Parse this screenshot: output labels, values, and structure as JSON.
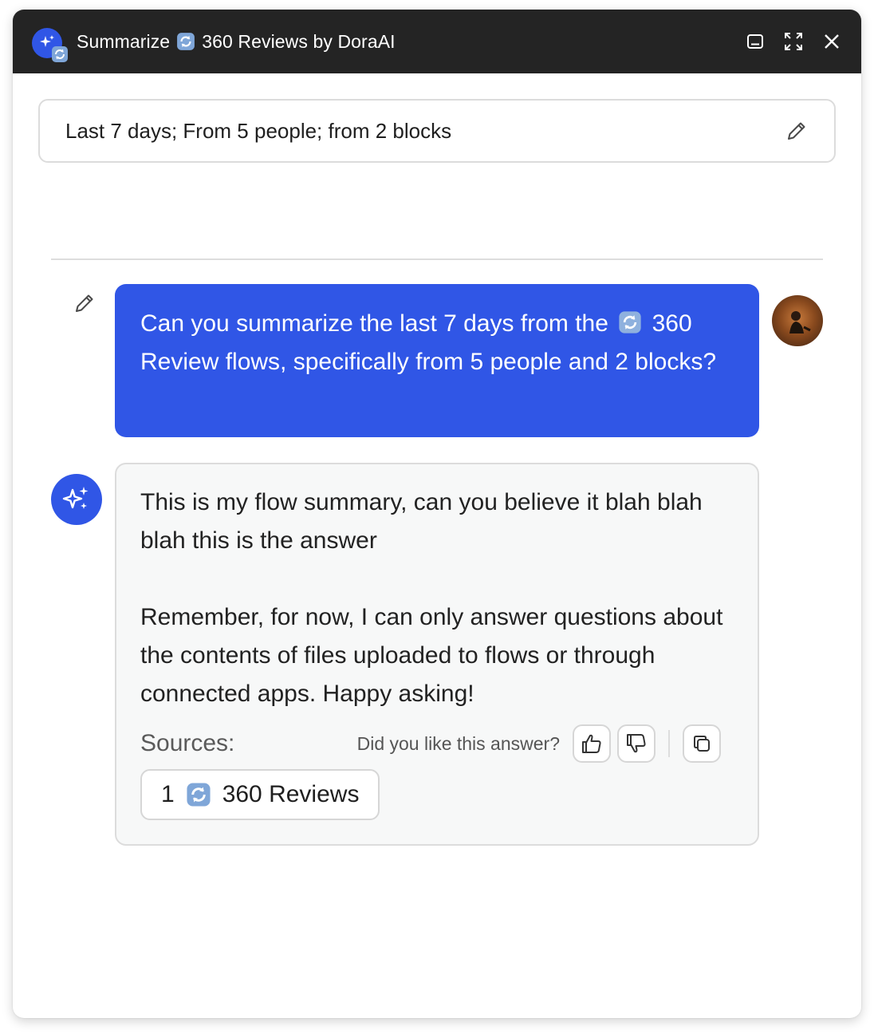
{
  "window": {
    "title_prefix": "Summarize",
    "title_suffix": "360 Reviews by DoraAI",
    "flow_emoji_icon": "arrows-counterclockwise-icon",
    "accent_color": "#3056e6",
    "titlebar_color": "#242424"
  },
  "filter": {
    "text": "Last 7 days; From 5 people; from 2 blocks",
    "edit_icon": "pencil-icon"
  },
  "conversation": {
    "user_message": {
      "part1": "Can you summarize the last 7 days from the",
      "part2": "360 Review flows, specifically from 5 people and 2 blocks?"
    },
    "bot_message": {
      "text": "This is my flow summary, can you believe it blah blah blah this is the answer\n\nRemember, for now, I can only answer questions about the contents of files uploaded to flows or through connected apps. Happy asking!",
      "sources_label": "Sources:",
      "feedback_question": "Did you like this answer?",
      "sources": [
        {
          "index": "1",
          "label": "360 Reviews"
        }
      ]
    }
  }
}
